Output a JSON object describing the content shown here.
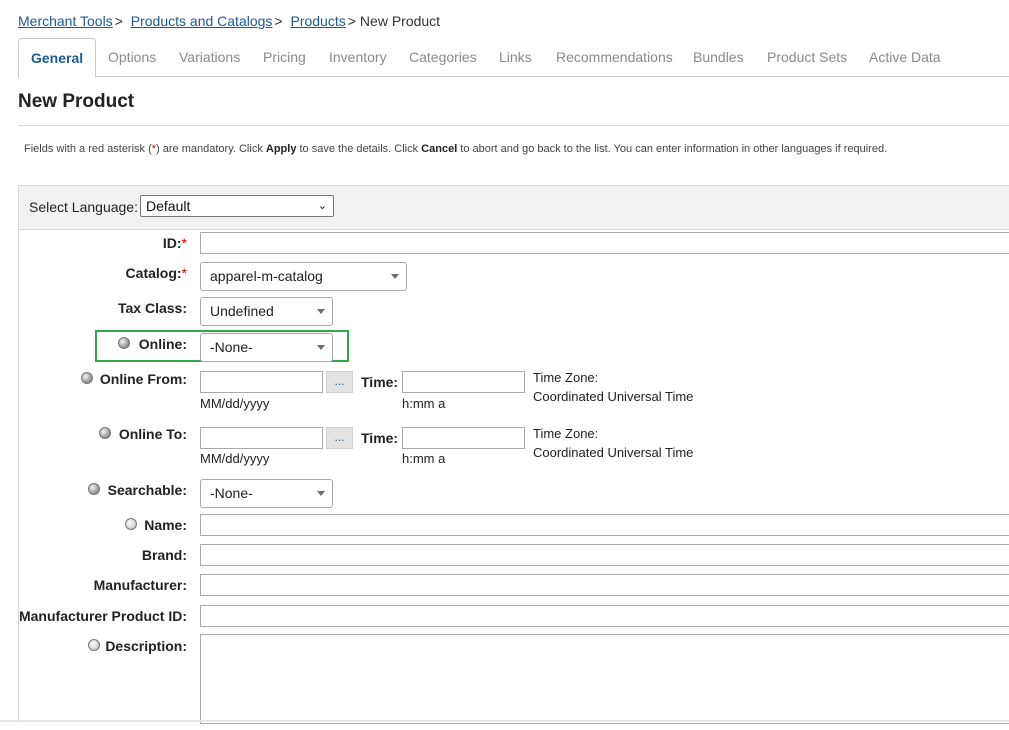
{
  "breadcrumb": {
    "items": [
      "Merchant Tools",
      "Products and Catalogs",
      "Products"
    ],
    "separator": ">",
    "current": "New Product"
  },
  "tabs": [
    "General",
    "Options",
    "Variations",
    "Pricing",
    "Inventory",
    "Categories",
    "Links",
    "Recommendations",
    "Bundles",
    "Product Sets",
    "Active Data"
  ],
  "active_tab": "General",
  "page_title": "New Product",
  "intro": {
    "p1": "Fields with a red asterisk (",
    "asterisk": "*",
    "p2": ") are mandatory. Click ",
    "apply": "Apply",
    "p3": " to save the details. Click ",
    "cancel": "Cancel",
    "p4": " to abort and go back to the list. You can enter information in other languages if required."
  },
  "language": {
    "label": "Select Language:",
    "value": "Default"
  },
  "form": {
    "id_label": "ID:",
    "catalog_label": "Catalog:",
    "catalog_value": "apparel-m-catalog",
    "tax_label": "Tax Class:",
    "tax_value": "Undefined",
    "online_label": "Online:",
    "online_value": "-None-",
    "online_from_label": "Online From:",
    "online_to_label": "Online To:",
    "time_label": "Time:",
    "date_format": "MM/dd/yyyy",
    "time_format": "h:mm a",
    "timezone_label": "Time Zone:",
    "timezone_value": "Coordinated Universal Time",
    "picker_label": "...",
    "searchable_label": "Searchable:",
    "searchable_value": "-None-",
    "name_label": "Name:",
    "brand_label": "Brand:",
    "manufacturer_label": "Manufacturer:",
    "manufacturer_product_id_label": "Manufacturer Product ID:",
    "description_label": "Description:",
    "required_mark": "*"
  },
  "colors": {
    "link": "#1a5a96",
    "required": "#cc0000",
    "highlight": "#2ea84a"
  }
}
